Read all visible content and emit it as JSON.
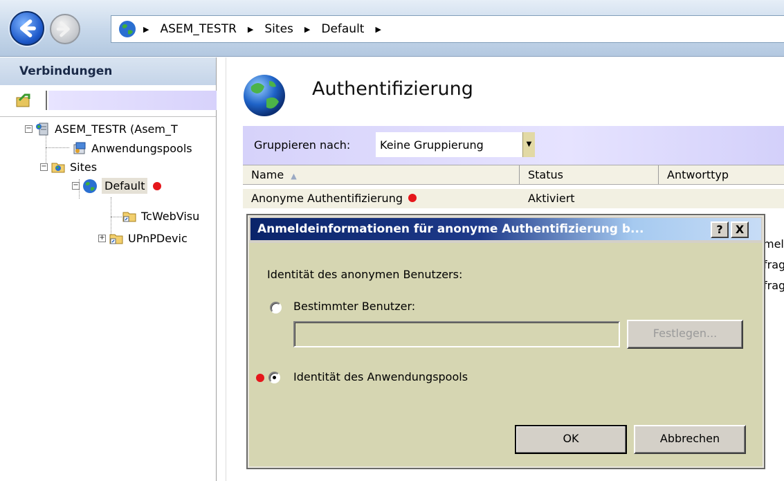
{
  "address_bar": {
    "crumbs": [
      "ASEM_TESTR",
      "Sites",
      "Default"
    ]
  },
  "connections": {
    "header": "Verbindungen",
    "tree": [
      {
        "label": "ASEM_TESTR (Asem_T",
        "icon": "server-icon"
      },
      {
        "label": "Anwendungspools",
        "icon": "app-pools-icon"
      },
      {
        "label": "Sites",
        "icon": "sites-folder-icon"
      },
      {
        "label": "Default",
        "icon": "globe-icon",
        "marked": true
      },
      {
        "label": "TcWebVisu",
        "icon": "app-folder-icon"
      },
      {
        "label": "UPnPDevic",
        "icon": "app-folder-icon"
      }
    ]
  },
  "main": {
    "title": "Authentifizierung",
    "group_by_label": "Gruppieren nach:",
    "group_by_value": "Keine Gruppierung",
    "columns": [
      "Name",
      "Status",
      "Antworttyp"
    ],
    "rows": [
      {
        "name": "Anonyme Authentifizierung",
        "status": "Aktiviert",
        "marked": true
      }
    ],
    "obscured_text": [
      "mel",
      "frag",
      "frag"
    ]
  },
  "dialog": {
    "title": "Anmeldeinformationen für anonyme Authentifizierung b...",
    "help_label": "?",
    "close_label": "X",
    "identity_label": "Identität des anonymen Benutzers:",
    "option_specific_user": "Bestimmter Benutzer:",
    "specific_user_value": "",
    "set_button": "Festlegen...",
    "option_app_pool": "Identität des Anwendungspools",
    "selected_option": "app_pool",
    "ok_button": "OK",
    "cancel_button": "Abbrechen"
  },
  "colors": {
    "marker_red": "#e5161b",
    "dialog_title_start": "#0a246a",
    "dialog_title_end": "#c7dcf6",
    "dialog_body": "#d6d6b2"
  }
}
